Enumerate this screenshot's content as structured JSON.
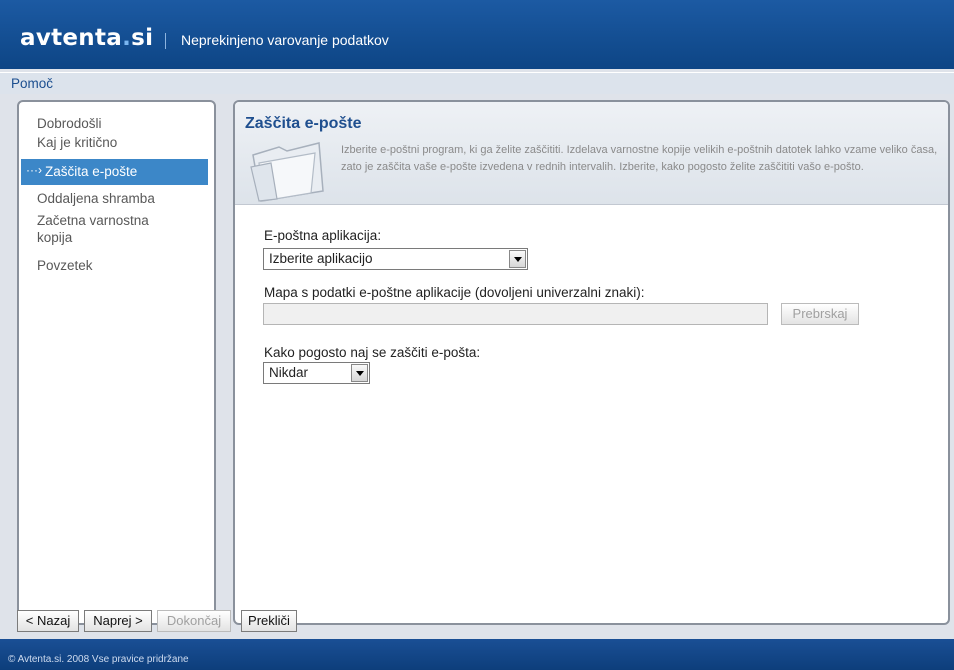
{
  "header": {
    "logo_left": "avtenta",
    "logo_dot": ".",
    "logo_right": "si",
    "tagline": "Neprekinjeno varovanje podatkov"
  },
  "helpbar": {
    "help_link": "Pomoč"
  },
  "sidebar": {
    "items": [
      {
        "label": "Dobrodošli",
        "active": false
      },
      {
        "label": "Kaj je kritično",
        "active": false
      },
      {
        "label": "Zaščita e-pošte",
        "active": true
      },
      {
        "label": "Oddaljena shramba",
        "active": false
      },
      {
        "label": "Začetna varnostna",
        "active": false
      },
      {
        "label": "kopija",
        "active": false
      },
      {
        "label": "Povzetek",
        "active": false
      }
    ]
  },
  "main": {
    "title": "Zaščita e-pošte",
    "description": "Izberite e-poštni program, ki ga želite zaščititi. Izdelava varnostne kopije velikih e-poštnih datotek lahko vzame veliko časa, zato je zaščita vaše e-pošte izvedena v rednih intervalih. Izberite, kako pogosto želite zaščititi vašo e-pošto.",
    "email_app_label": "E-poštna aplikacija:",
    "email_app_value": "Izberite aplikacijo",
    "folder_label": "Mapa s podatki e-poštne aplikacije (dovoljeni univerzalni znaki):",
    "folder_value": "",
    "browse_button": "Prebrskaj",
    "frequency_label": "Kako pogosto naj se zaščiti e-pošta:",
    "frequency_value": "Nikdar"
  },
  "nav": {
    "back": "< Nazaj",
    "next": "Naprej >",
    "finish": "Dokončaj",
    "cancel": "Prekliči"
  },
  "footer": {
    "copyright": "© Avtenta.si. 2008 Vse pravice pridržane"
  },
  "colors": {
    "brand_blue": "#1c5aa3",
    "active_item": "#3c87c8",
    "title_blue": "#1f4f8f"
  }
}
